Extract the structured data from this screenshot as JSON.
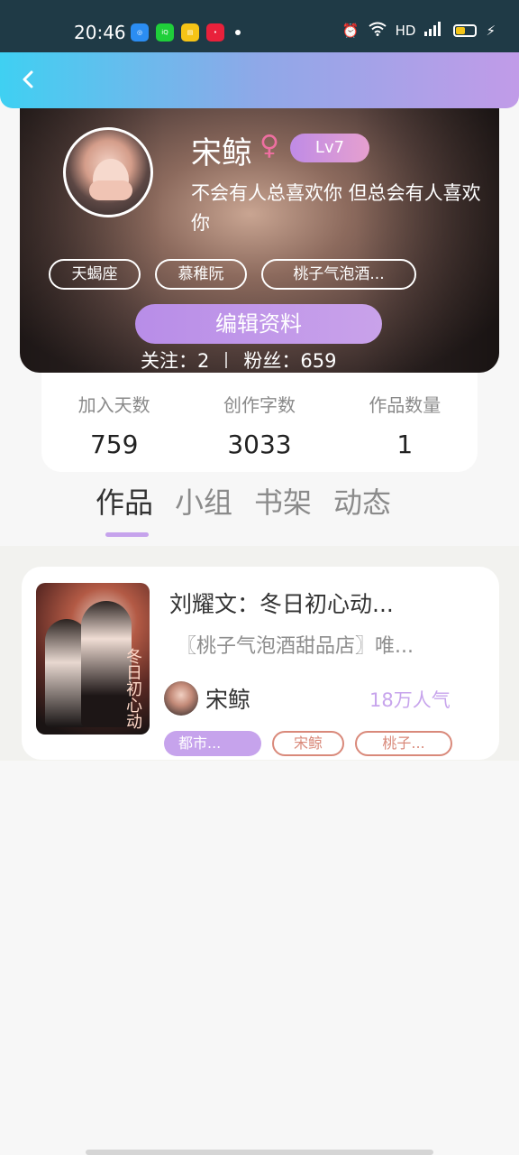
{
  "status_bar": {
    "time": "20:46",
    "apps": [
      "app-icon-blue",
      "iqiyi-icon",
      "notes-icon",
      "red-app-icon"
    ],
    "network": "HD",
    "signal": "5G"
  },
  "profile": {
    "name": "宋鲸",
    "gender_symbol": "♀",
    "level": "Lv7",
    "bio": "不会有人总喜欢你 但总会有人喜欢你",
    "tags": [
      "天蝎座",
      "慕稚阮",
      "桃子气泡酒..."
    ],
    "edit_button": "编辑资料",
    "follow_label": "关注：",
    "follow_count": "2",
    "fans_label": "粉丝：",
    "fans_count": "659"
  },
  "stats": [
    {
      "label": "加入天数",
      "value": "759"
    },
    {
      "label": "创作字数",
      "value": "3033"
    },
    {
      "label": "作品数量",
      "value": "1"
    }
  ],
  "tabs": [
    "作品",
    "小组",
    "书架",
    "动态"
  ],
  "active_tab": "作品",
  "works": [
    {
      "title": "刘耀文：冬日初心动...",
      "description": "〖桃子气泡酒甜品店〗唯...",
      "cover_text": "冬日初心动",
      "author": "宋鲸",
      "popularity": "18万人气",
      "tags": [
        "都市...",
        "宋鲸",
        "桃子..."
      ]
    }
  ],
  "colors": {
    "accent": "#c6a3ec",
    "header_gradient_start": "#3fd0f2",
    "header_gradient_end": "#c19be8",
    "tag_red": "#d9897a"
  }
}
